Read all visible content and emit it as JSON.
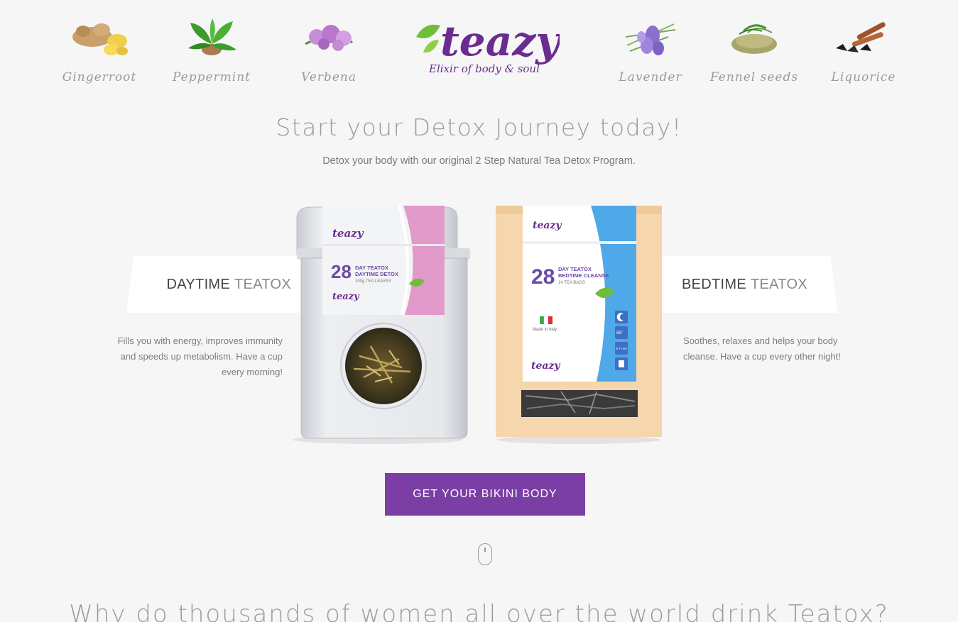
{
  "ingredients_left": [
    {
      "label": "Gingerroot",
      "icon": "ginger-icon"
    },
    {
      "label": "Peppermint",
      "icon": "peppermint-icon"
    },
    {
      "label": "Verbena",
      "icon": "verbena-icon"
    }
  ],
  "ingredients_right": [
    {
      "label": "Lavender",
      "icon": "lavender-icon"
    },
    {
      "label": "Fennel seeds",
      "icon": "fennel-seeds-icon"
    },
    {
      "label": "Liquorice",
      "icon": "liquorice-icon"
    }
  ],
  "logo": {
    "name": "teazy",
    "tagline": "Elixir of body & soul"
  },
  "hero": {
    "title": "Start your Detox Journey today!",
    "subtitle": "Detox your body with our original 2 Step Natural Tea Detox Program."
  },
  "daytime": {
    "title_dark": "DAYTIME",
    "title_light": "TEATOX",
    "description": "Fills you with energy, improves immunity and speeds up metabolism. Have a cup every morning!",
    "pack": {
      "number": "28",
      "line1": "DAY TEATOX",
      "line2": "DAYTIME DETOX",
      "line3": "100g TEA LEAVES"
    }
  },
  "bedtime": {
    "title_dark": "BEDTIME",
    "title_light": "TEATOX",
    "description": "Soothes, relaxes and helps your body cleanse. Have a cup every other night!",
    "pack": {
      "number": "28",
      "line1": "DAY TEATOX",
      "line2": "BEDTIME CLEANSE",
      "line3": "14 TEA BAGS",
      "made_in": "Made in Italy",
      "temp": "85°",
      "time": "5-7 min"
    }
  },
  "cta": {
    "label": "GET YOUR BIKINI BODY"
  },
  "section": {
    "why_title": "Why do thousands of women all over the world drink Teatox?"
  },
  "colors": {
    "brand_purple": "#7a3ea4",
    "logo_purple": "#6b2c91",
    "leaf_green": "#6fbe3a",
    "pink_stripe": "#e19ac9",
    "blue_stripe": "#4fa8e8"
  }
}
